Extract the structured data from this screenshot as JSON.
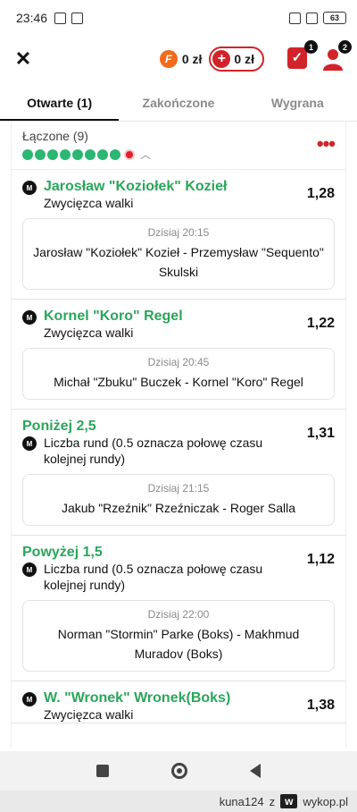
{
  "status_bar": {
    "time": "23:46",
    "battery": "63"
  },
  "header": {
    "coin_value": "0 zł",
    "balance_value": "0 zł",
    "coupon_badge": "1",
    "profile_badge": "2",
    "colors": {
      "brand_red": "#d2232a",
      "accent_orange": "#f26a1b",
      "win_green": "#2aa65b"
    }
  },
  "tabs": [
    {
      "label": "Otwarte (1)",
      "active": true
    },
    {
      "label": "Zakończone",
      "active": false
    },
    {
      "label": "Wygrana",
      "active": false
    }
  ],
  "group": {
    "title": "Łączone (9)"
  },
  "bets": [
    {
      "selection": "Jarosław \"Koziołek\" Kozieł",
      "market": "Zwycięzca walki",
      "odds": "1,28",
      "time": "Dzisiaj 20:15",
      "event": "Jarosław \"Koziołek\" Kozieł - Przemysław \"Sequento\" Skulski"
    },
    {
      "selection": "Kornel \"Koro\" Regel",
      "market": "Zwycięzca walki",
      "odds": "1,22",
      "time": "Dzisiaj 20:45",
      "event": "Michał \"Zbuku\" Buczek - Kornel \"Koro\" Regel"
    },
    {
      "selection": "Poniżej 2,5",
      "market": "Liczba rund (0.5 oznacza połowę czasu kolejnej rundy)",
      "odds": "1,31",
      "time": "Dzisiaj 21:15",
      "event": "Jakub \"Rzeźnik\" Rzeźniczak - Roger Salla"
    },
    {
      "selection": "Powyżej 1,5",
      "market": "Liczba rund (0.5 oznacza połowę czasu kolejnej rundy)",
      "odds": "1,12",
      "time": "Dzisiaj 22:00",
      "event": "Norman \"Stormin\" Parke (Boks) - Makhmud Muradov (Boks)"
    },
    {
      "selection": "W. \"Wronek\" Wronek(Boks)",
      "market": "Zwycięzca walki",
      "odds": "1,38",
      "time": "",
      "event": ""
    }
  ],
  "footer": {
    "user": "kuna124",
    "separator": "z",
    "site": "wykop.pl"
  }
}
